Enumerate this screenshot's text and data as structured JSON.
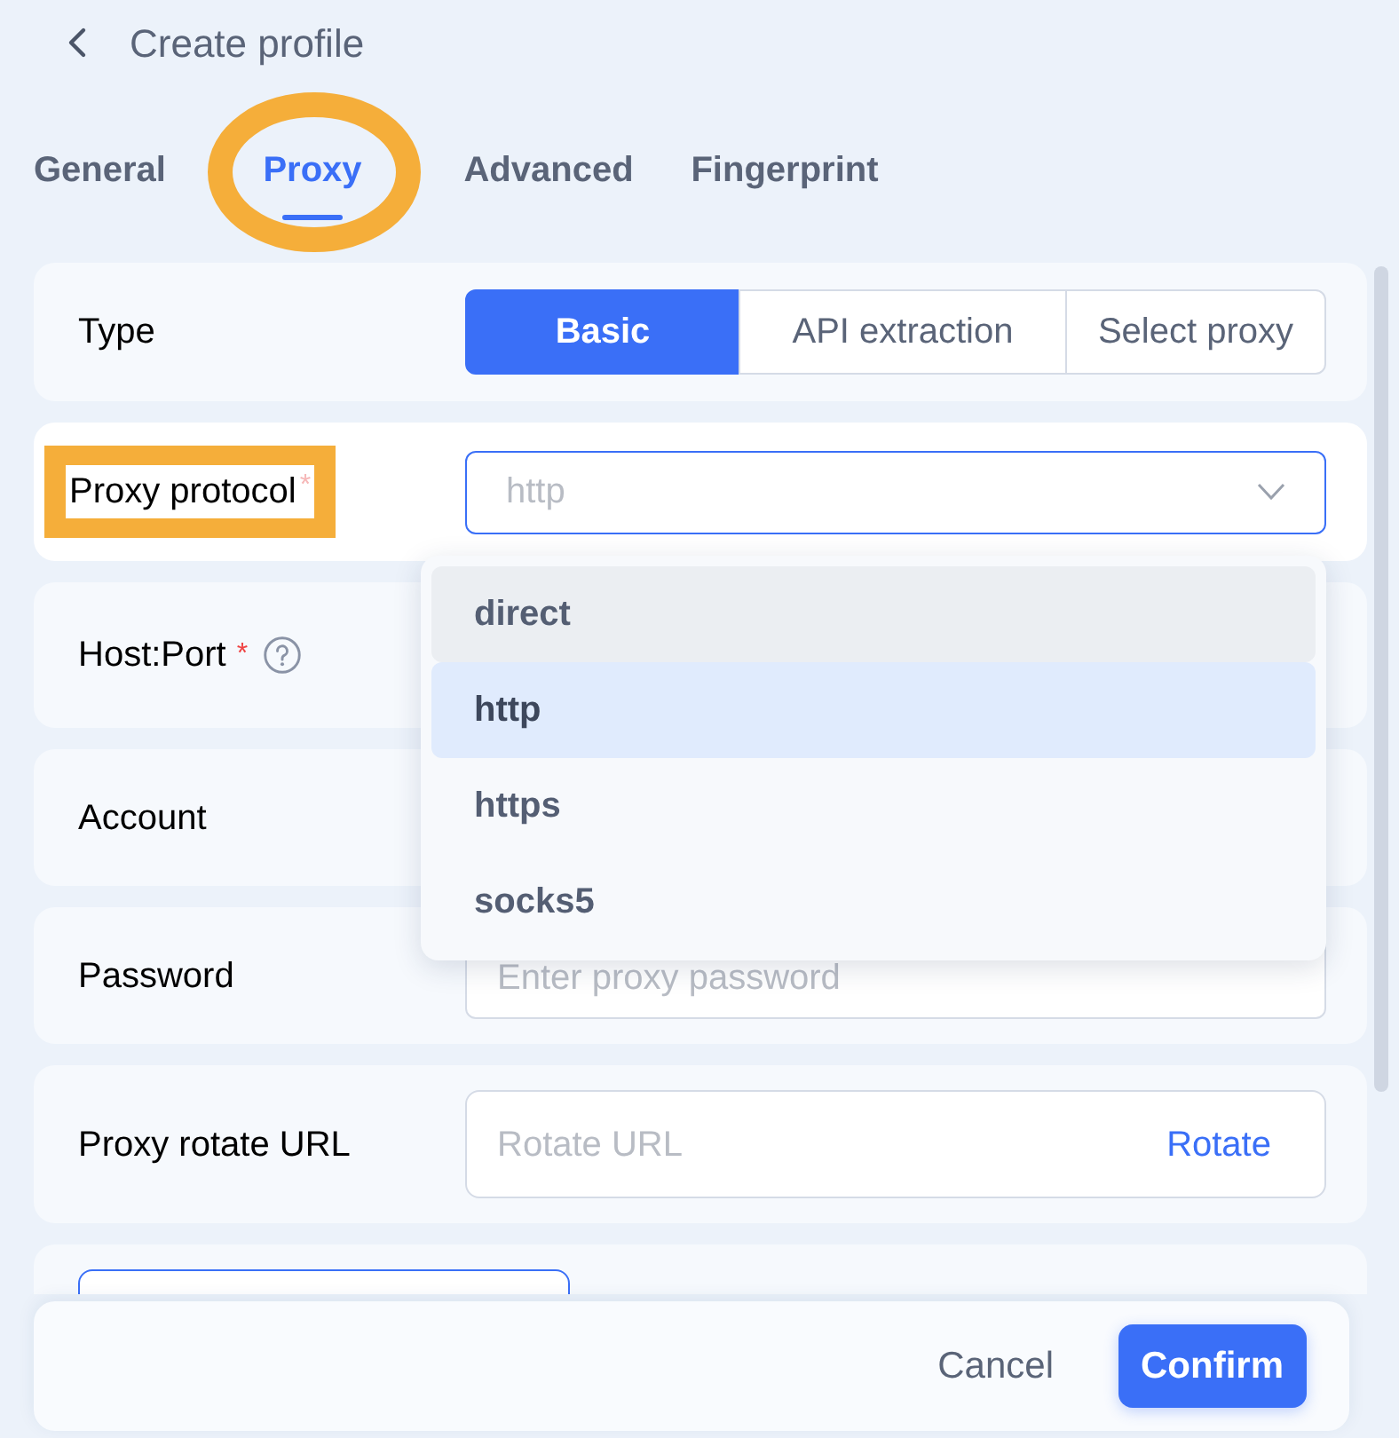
{
  "header": {
    "title": "Create profile"
  },
  "tabs": [
    {
      "label": "General",
      "selected": false,
      "highlighted": false
    },
    {
      "label": "Proxy",
      "selected": true,
      "highlighted": true
    },
    {
      "label": "Advanced",
      "selected": false,
      "highlighted": false
    },
    {
      "label": "Fingerprint",
      "selected": false,
      "highlighted": false
    }
  ],
  "fields": [
    {
      "kind": "segmented",
      "label": "Type",
      "options": [
        {
          "label": "Basic",
          "selected": true
        },
        {
          "label": "API extraction",
          "selected": false
        },
        {
          "label": "Select proxy",
          "selected": false
        }
      ]
    },
    {
      "kind": "select",
      "label": "Proxy protocol",
      "required_mark": "*",
      "highlighted": true,
      "placeholder": "http",
      "expanded": true,
      "options": [
        {
          "label": "direct",
          "selected": false,
          "hovered": true
        },
        {
          "label": "http",
          "selected": true,
          "hovered": false
        },
        {
          "label": "https",
          "selected": false,
          "hovered": false
        },
        {
          "label": "socks5",
          "selected": false,
          "hovered": false
        }
      ]
    },
    {
      "kind": "hidden",
      "label": "Host:Port",
      "required_mark": "*",
      "help": true
    },
    {
      "kind": "hidden",
      "label": "Account"
    },
    {
      "kind": "text",
      "label": "Password",
      "placeholder": "Enter proxy password"
    },
    {
      "kind": "action",
      "label": "Proxy rotate URL",
      "placeholder": "Rotate URL",
      "action": "Rotate"
    },
    {
      "kind": "partial"
    }
  ],
  "footer": {
    "buttons": [
      {
        "label": "Cancel",
        "kind": "text"
      },
      {
        "label": "Confirm",
        "kind": "primary"
      }
    ]
  }
}
